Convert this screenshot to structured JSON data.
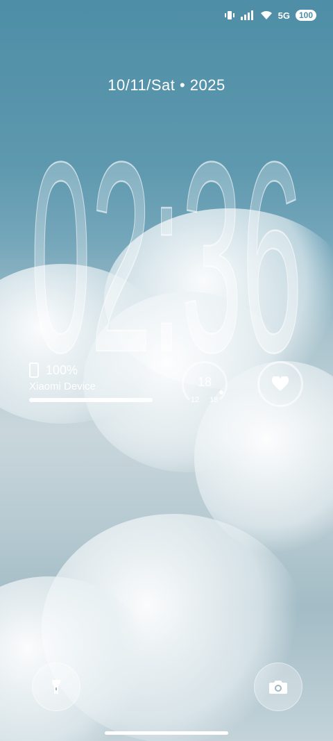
{
  "status": {
    "network": "5G",
    "battery": "100"
  },
  "lockscreen": {
    "date": "10/11/Sat • 2025",
    "time": "02:36"
  },
  "battery_widget": {
    "percent": "100%",
    "device_name": "Xiaomi Device"
  },
  "weather": {
    "temp": "18",
    "low": "12",
    "high": "18"
  },
  "icons": {
    "vibrate": "vibrate-icon",
    "signal": "signal-icon",
    "wifi": "wifi-icon",
    "heart": "heart-icon",
    "flashlight": "flashlight-icon",
    "camera": "camera-icon"
  }
}
